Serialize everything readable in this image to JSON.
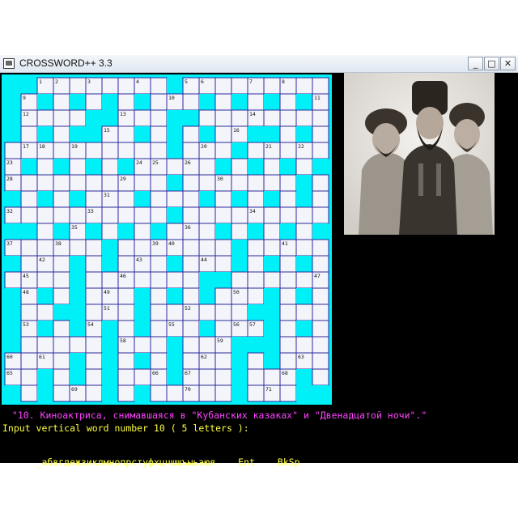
{
  "window": {
    "title": "CROSSWORD++ 3.3",
    "buttons": {
      "minimize": "_",
      "maximize": "□",
      "close": "✕"
    }
  },
  "colors": {
    "cell_fill": "#f4f5fb",
    "blocked": "#00f0f8",
    "grid_line": "#2a2a9a",
    "clue": "#ff44ff",
    "prompt": "#ffff40"
  },
  "grid": {
    "size": 20,
    "cell_numbers": [
      {
        "r": 0,
        "c": 2,
        "n": "1"
      },
      {
        "r": 0,
        "c": 3,
        "n": "2"
      },
      {
        "r": 0,
        "c": 5,
        "n": "3"
      },
      {
        "r": 0,
        "c": 8,
        "n": "4"
      },
      {
        "r": 0,
        "c": 11,
        "n": "5"
      },
      {
        "r": 0,
        "c": 12,
        "n": "6"
      },
      {
        "r": 0,
        "c": 15,
        "n": "7"
      },
      {
        "r": 0,
        "c": 17,
        "n": "8"
      },
      {
        "r": 1,
        "c": 1,
        "n": "9"
      },
      {
        "r": 1,
        "c": 10,
        "n": "10"
      },
      {
        "r": 1,
        "c": 19,
        "n": "11"
      },
      {
        "r": 2,
        "c": 1,
        "n": "12"
      },
      {
        "r": 2,
        "c": 7,
        "n": "13"
      },
      {
        "r": 2,
        "c": 15,
        "n": "14"
      },
      {
        "r": 3,
        "c": 6,
        "n": "15"
      },
      {
        "r": 3,
        "c": 14,
        "n": "16"
      },
      {
        "r": 4,
        "c": 1,
        "n": "17"
      },
      {
        "r": 4,
        "c": 2,
        "n": "18"
      },
      {
        "r": 4,
        "c": 4,
        "n": "19"
      },
      {
        "r": 4,
        "c": 12,
        "n": "20"
      },
      {
        "r": 4,
        "c": 16,
        "n": "21"
      },
      {
        "r": 4,
        "c": 18,
        "n": "22"
      },
      {
        "r": 5,
        "c": 0,
        "n": "23"
      },
      {
        "r": 5,
        "c": 8,
        "n": "24"
      },
      {
        "r": 5,
        "c": 9,
        "n": "25"
      },
      {
        "r": 5,
        "c": 11,
        "n": "26"
      },
      {
        "r": 6,
        "c": 0,
        "n": "28"
      },
      {
        "r": 6,
        "c": 7,
        "n": "29"
      },
      {
        "r": 6,
        "c": 13,
        "n": "30"
      },
      {
        "r": 7,
        "c": 6,
        "n": "31"
      },
      {
        "r": 8,
        "c": 0,
        "n": "32"
      },
      {
        "r": 8,
        "c": 5,
        "n": "33"
      },
      {
        "r": 8,
        "c": 15,
        "n": "34"
      },
      {
        "r": 9,
        "c": 4,
        "n": "35"
      },
      {
        "r": 9,
        "c": 11,
        "n": "36"
      },
      {
        "r": 10,
        "c": 0,
        "n": "37"
      },
      {
        "r": 10,
        "c": 3,
        "n": "38"
      },
      {
        "r": 10,
        "c": 9,
        "n": "39"
      },
      {
        "r": 10,
        "c": 10,
        "n": "40"
      },
      {
        "r": 10,
        "c": 17,
        "n": "41"
      },
      {
        "r": 11,
        "c": 2,
        "n": "42"
      },
      {
        "r": 11,
        "c": 8,
        "n": "43"
      },
      {
        "r": 11,
        "c": 12,
        "n": "44"
      },
      {
        "r": 12,
        "c": 1,
        "n": "45"
      },
      {
        "r": 12,
        "c": 7,
        "n": "46"
      },
      {
        "r": 12,
        "c": 19,
        "n": "47"
      },
      {
        "r": 13,
        "c": 1,
        "n": "48"
      },
      {
        "r": 13,
        "c": 6,
        "n": "49"
      },
      {
        "r": 13,
        "c": 14,
        "n": "50"
      },
      {
        "r": 14,
        "c": 6,
        "n": "51"
      },
      {
        "r": 14,
        "c": 11,
        "n": "52"
      },
      {
        "r": 15,
        "c": 1,
        "n": "53"
      },
      {
        "r": 15,
        "c": 5,
        "n": "54"
      },
      {
        "r": 15,
        "c": 10,
        "n": "55"
      },
      {
        "r": 15,
        "c": 14,
        "n": "56"
      },
      {
        "r": 15,
        "c": 15,
        "n": "57"
      },
      {
        "r": 16,
        "c": 7,
        "n": "58"
      },
      {
        "r": 16,
        "c": 13,
        "n": "59"
      },
      {
        "r": 17,
        "c": 0,
        "n": "60"
      },
      {
        "r": 17,
        "c": 2,
        "n": "61"
      },
      {
        "r": 17,
        "c": 12,
        "n": "62"
      },
      {
        "r": 17,
        "c": 18,
        "n": "63"
      },
      {
        "r": 18,
        "c": 0,
        "n": "65"
      },
      {
        "r": 18,
        "c": 9,
        "n": "66"
      },
      {
        "r": 18,
        "c": 11,
        "n": "67"
      },
      {
        "r": 18,
        "c": 17,
        "n": "68"
      },
      {
        "r": 19,
        "c": 4,
        "n": "69"
      },
      {
        "r": 19,
        "c": 11,
        "n": "70"
      },
      {
        "r": 19,
        "c": 16,
        "n": "71"
      }
    ]
  },
  "clue_text": " \"10. Киноактриса, снимавшаяся в \"Кубанских казаках\" и \"Двенадцатой ночи\".\"",
  "prompt_text": "Input vertical word number 10 ( 5 letters ):",
  "keyboard": {
    "letters": "_абвгдежзиклмнопрстуфхцчшщъыьэюя",
    "enter": "Ent",
    "backspace": "BkSp"
  }
}
